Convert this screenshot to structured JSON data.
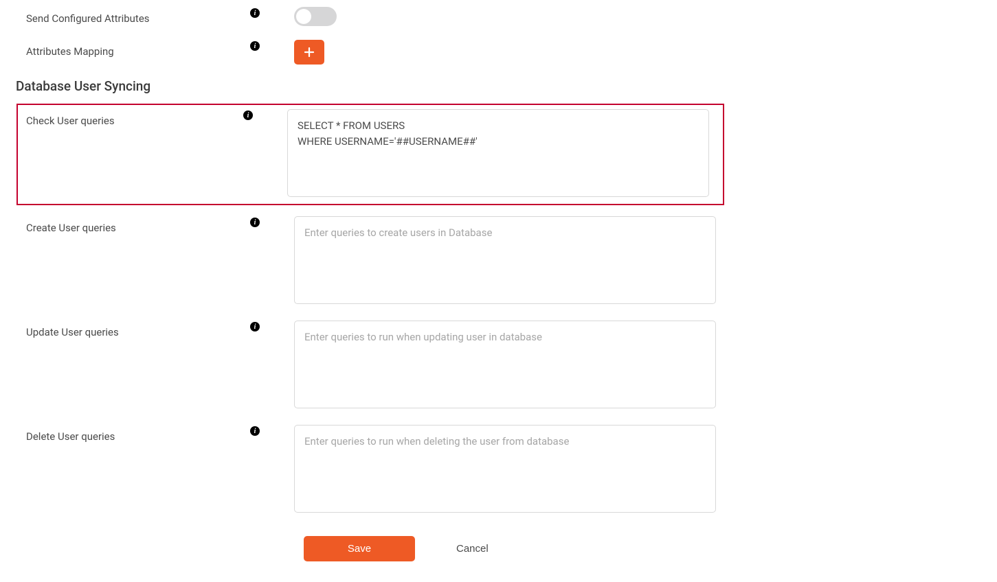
{
  "fields": {
    "send_configured_attributes": {
      "label": "Send Configured Attributes"
    },
    "attributes_mapping": {
      "label": "Attributes Mapping"
    }
  },
  "section": {
    "title": "Database User Syncing"
  },
  "queries": {
    "check_user": {
      "label": "Check User queries",
      "value": "SELECT * FROM USERS\nWHERE USERNAME='##USERNAME##'"
    },
    "create_user": {
      "label": "Create User queries",
      "placeholder": "Enter queries to create users in Database",
      "value": ""
    },
    "update_user": {
      "label": "Update User queries",
      "placeholder": "Enter queries to run when updating user in database",
      "value": ""
    },
    "delete_user": {
      "label": "Delete User queries",
      "placeholder": "Enter queries to run when deleting the user from database",
      "value": ""
    }
  },
  "buttons": {
    "save": "Save",
    "cancel": "Cancel"
  }
}
